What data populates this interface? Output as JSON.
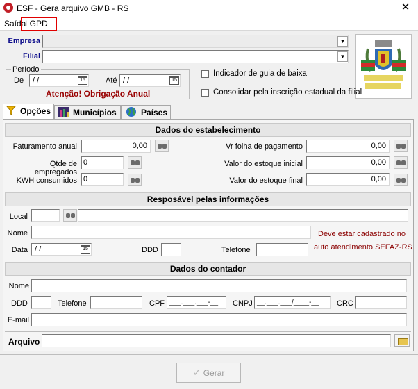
{
  "window": {
    "title": "ESF - Gera arquivo GMB - RS",
    "close_glyph": "✕"
  },
  "menu": {
    "saida": "Saída",
    "lgpd": "LGPD"
  },
  "header": {
    "empresa_label": "Empresa",
    "filial_label": "Filial",
    "periodo_legend": "Período",
    "de_label": "De",
    "ate_label": "Até",
    "date_mask": "/ /",
    "cal_glyph": "15",
    "warning": "Atenção! Obrigação Anual",
    "check_guia": "Indicador de guia de baixa",
    "check_consolidar": "Consolidar pela inscrição estadual da filial"
  },
  "tabs": [
    {
      "label": "Opções",
      "icon": "funnel-icon"
    },
    {
      "label": "Municípios",
      "icon": "city-icon"
    },
    {
      "label": "Países",
      "icon": "globe-icon"
    }
  ],
  "estab": {
    "title": "Dados do estabelecimento",
    "faturamento_label": "Faturamento anual",
    "faturamento_value": "0,00",
    "qtde_label": "Qtde de empregados",
    "qtde_value": "0",
    "kwh_label": "KWH consumidos",
    "kwh_value": "0",
    "folha_label": "Vr folha de pagamento",
    "folha_value": "0,00",
    "estoque_ini_label": "Valor do estoque inicial",
    "estoque_ini_value": "0,00",
    "estoque_fim_label": "Valor do estoque final",
    "estoque_fim_value": "0,00"
  },
  "resp": {
    "title": "Resposável pelas informações",
    "local_label": "Local",
    "nome_label": "Nome",
    "data_label": "Data",
    "data_value": "/ /",
    "ddd_label": "DDD",
    "telefone_label": "Telefone",
    "note_line1": "Deve estar cadastrado no",
    "note_line2": "auto atendimento SEFAZ-RS"
  },
  "contador": {
    "title": "Dados do contador",
    "nome_label": "Nome",
    "ddd_label": "DDD",
    "telefone_label": "Telefone",
    "cpf_label": "CPF",
    "cpf_mask": "___.___.___-__",
    "cnpj_label": "CNPJ",
    "cnpj_mask": "__.___.___/____-__",
    "crc_label": "CRC",
    "email_label": "E-mail"
  },
  "arquivo_label": "Arquivo",
  "gerar_label": "Gerar",
  "colors": {
    "accent_red": "#e00000",
    "label_blue": "#0b0b8a",
    "warning_red": "#990000"
  }
}
